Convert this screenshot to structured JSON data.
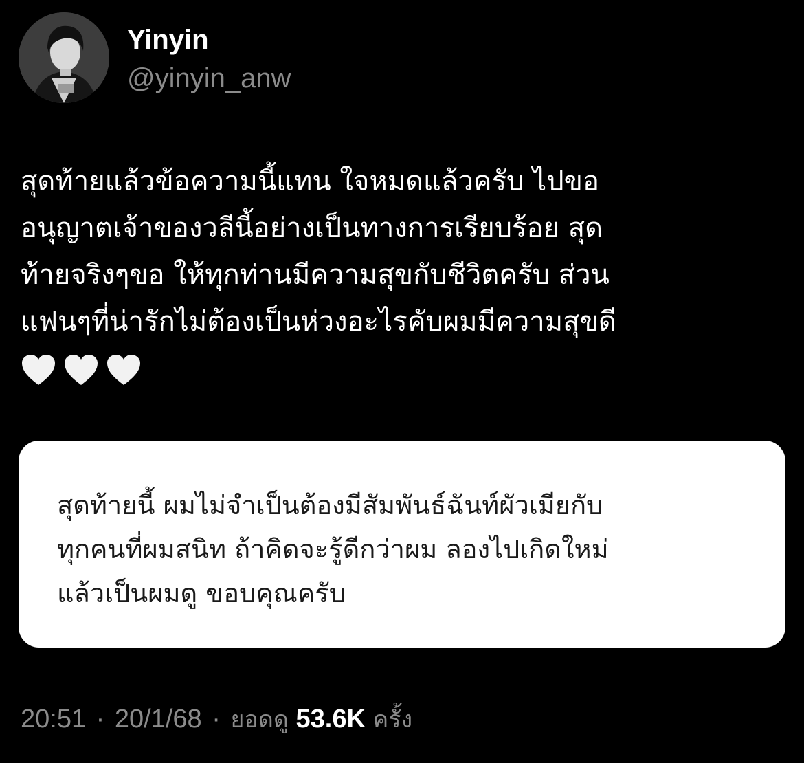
{
  "author": {
    "display_name": "Yinyin",
    "handle": "@yinyin_anw",
    "avatar_icon": "profile-photo"
  },
  "tweet": {
    "text_lines": [
      "สุดท้ายแล้วข้อความนี้แทน ใจหมดแล้วครับ ไปขอ",
      "อนุญาตเจ้าของวลีนี้อย่างเป็นทางการเรียบร้อย สุด",
      "ท้ายจริงๆขอ ให้ทุกท่านมีความสุขกับชีวิตครับ ส่วน",
      "แฟนๆที่น่ารักไม่ต้องเป็นห่วงอะไรคับผมมีความสุขดี"
    ],
    "emoji": [
      "white-heart",
      "white-heart",
      "white-heart"
    ]
  },
  "attached_card": {
    "lines": [
      "สุดท้ายนี้ ผมไม่จำเป็นต้องมีสัมพันธ์ฉันท์ผัวเมียกับ",
      "ทุกคนที่ผมสนิท ถ้าคิดจะรู้ดีกว่าผม ลองไปเกิดใหม่",
      "แล้วเป็นผมดู ขอบคุณครับ"
    ]
  },
  "meta": {
    "time": "20:51",
    "separator": "·",
    "date": "20/1/68",
    "views_label": "ยอดดู",
    "views_count": "53.6K",
    "views_suffix": "ครั้ง"
  },
  "colors": {
    "background": "#000000",
    "primary_text": "#ffffff",
    "secondary_text": "#8b8b8b",
    "card_background": "#ffffff",
    "card_text": "#1a1a1a"
  }
}
